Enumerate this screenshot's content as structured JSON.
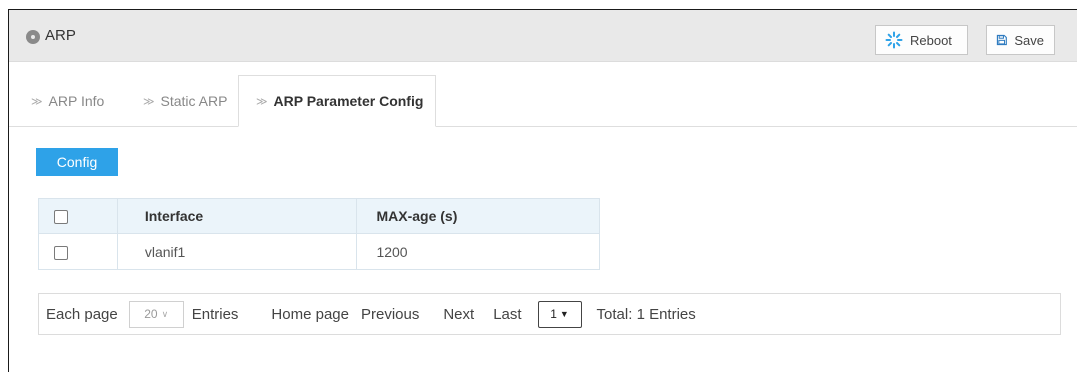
{
  "header": {
    "title": "ARP",
    "reboot_label": "Reboot",
    "save_label": "Save"
  },
  "tabs": [
    {
      "label": "ARP Info"
    },
    {
      "label": "Static ARP"
    },
    {
      "label": "ARP Parameter Config",
      "active": true
    }
  ],
  "toolbar": {
    "config_label": "Config"
  },
  "table": {
    "columns": [
      "Interface",
      "MAX-age (s)"
    ],
    "rows": [
      {
        "interface": "vlanif1",
        "max_age": "1200"
      }
    ]
  },
  "pagination": {
    "each_page_label": "Each page",
    "page_size": "20",
    "entries_label": "Entries",
    "home_label": "Home page",
    "previous_label": "Previous",
    "next_label": "Next",
    "last_label": "Last",
    "current_page": "1",
    "total_label": "Total: 1 Entries"
  },
  "colors": {
    "accent": "#2ea2e8",
    "header_bg": "#e9e9e9",
    "table_header_bg": "#ebf4fa"
  }
}
